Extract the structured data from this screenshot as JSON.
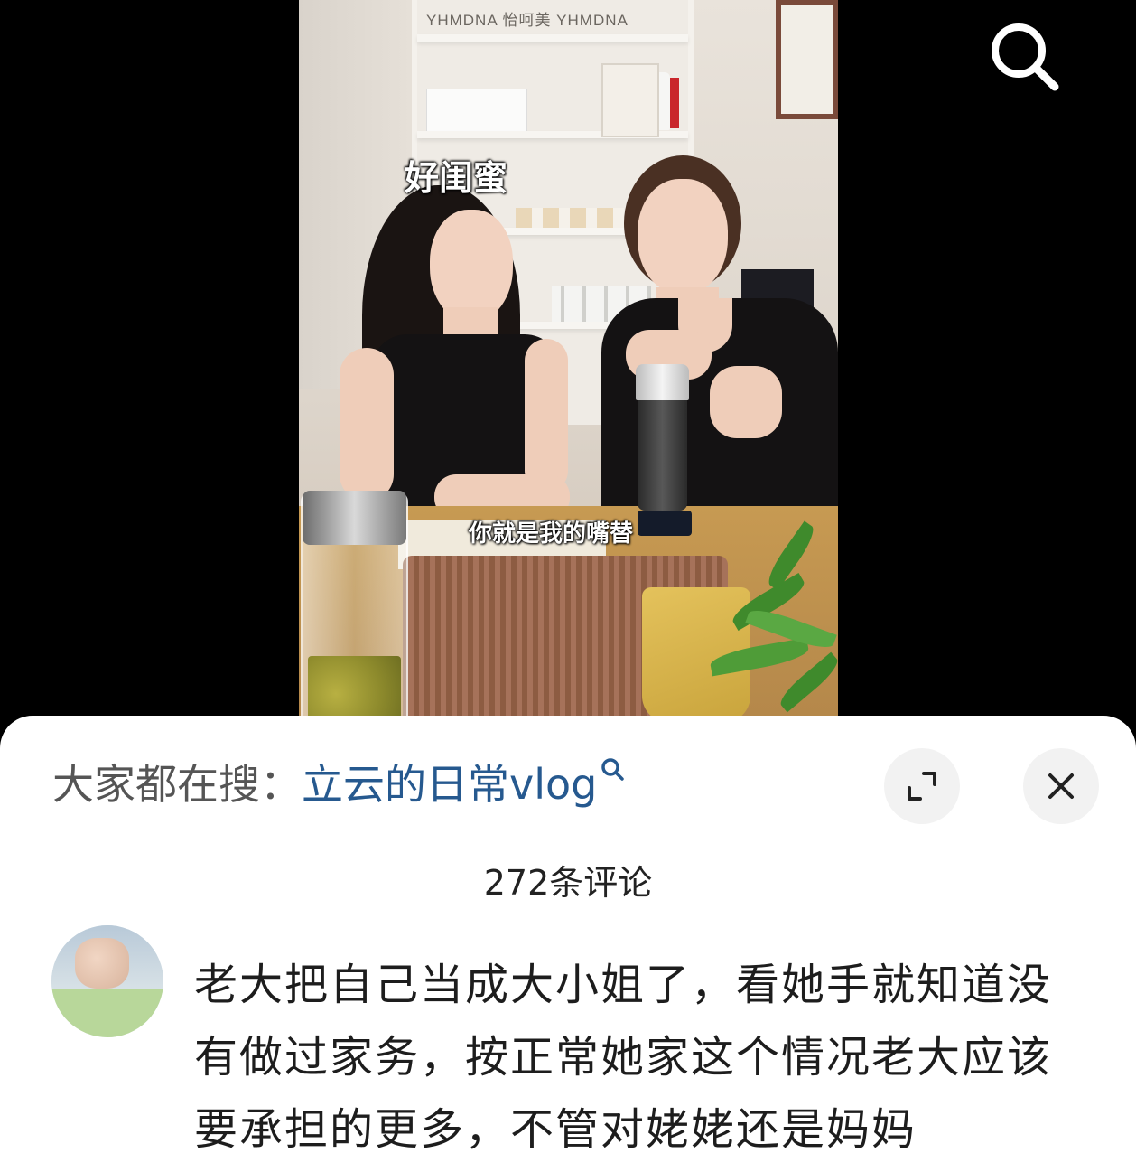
{
  "video": {
    "shelf_brand": "YHMDNA   怡呵美   YHMDNA",
    "caption_top": "好闺蜜",
    "subtitle": "你就是我的嘴替"
  },
  "top_bar": {
    "search_icon": "search-icon"
  },
  "sheet": {
    "search_prefix": "大家都在搜：",
    "search_term": "立云的日常vlog",
    "search_term_icon": "search-icon",
    "expand_icon": "expand-icon",
    "close_icon": "close-icon",
    "comment_count": "272条评论"
  },
  "comment": {
    "lines": [
      "老大把自己当成大小姐了，看她手就知道没",
      "有做过家务，按正常她家这个情况老大应该",
      "要承担的更多，不管对姥姥还是妈妈"
    ]
  },
  "colors": {
    "accent_link": "#26598f",
    "background": "#000000",
    "sheet": "#ffffff"
  }
}
